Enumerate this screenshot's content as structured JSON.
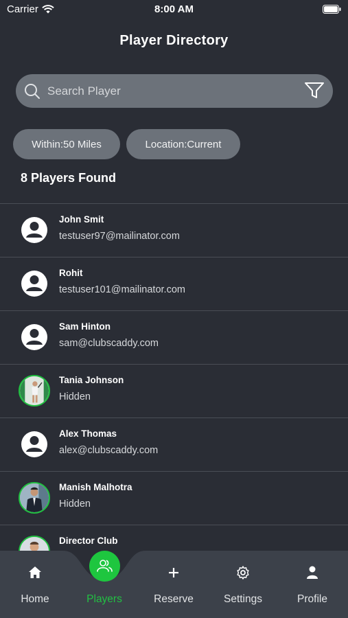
{
  "status_bar": {
    "carrier": "Carrier",
    "time": "8:00 AM"
  },
  "header": {
    "title": "Player Directory"
  },
  "search": {
    "placeholder": "Search Player",
    "value": ""
  },
  "filters": [
    {
      "label": "Within:50 Miles"
    },
    {
      "label": "Location:Current"
    }
  ],
  "results": {
    "count_label": "8 Players Found"
  },
  "players": [
    {
      "name": "John Smit",
      "detail": "testuser97@mailinator.com",
      "avatar": "default-avatar-icon"
    },
    {
      "name": "Rohit",
      "detail": "testuser101@mailinator.com",
      "avatar": "default-avatar-icon"
    },
    {
      "name": "Sam Hinton",
      "detail": "sam@clubscaddy.com",
      "avatar": "default-avatar-icon"
    },
    {
      "name": "Tania Johnson",
      "detail": "Hidden",
      "avatar": "photo"
    },
    {
      "name": "Alex Thomas",
      "detail": "alex@clubscaddy.com",
      "avatar": "default-avatar-icon"
    },
    {
      "name": "Manish Malhotra",
      "detail": "Hidden",
      "avatar": "photo"
    },
    {
      "name": "Director Club",
      "detail": "",
      "avatar": "photo"
    }
  ],
  "tabs": [
    {
      "label": "Home",
      "icon": "home-icon"
    },
    {
      "label": "Players",
      "icon": "players-icon",
      "active": true
    },
    {
      "label": "Reserve",
      "icon": "plus-icon"
    },
    {
      "label": "Settings",
      "icon": "gear-icon"
    },
    {
      "label": "Profile",
      "icon": "person-icon"
    }
  ],
  "colors": {
    "background": "#2a2d35",
    "accent": "#1ec63f",
    "field": "#6c727a",
    "tabbar": "#3c414a"
  }
}
